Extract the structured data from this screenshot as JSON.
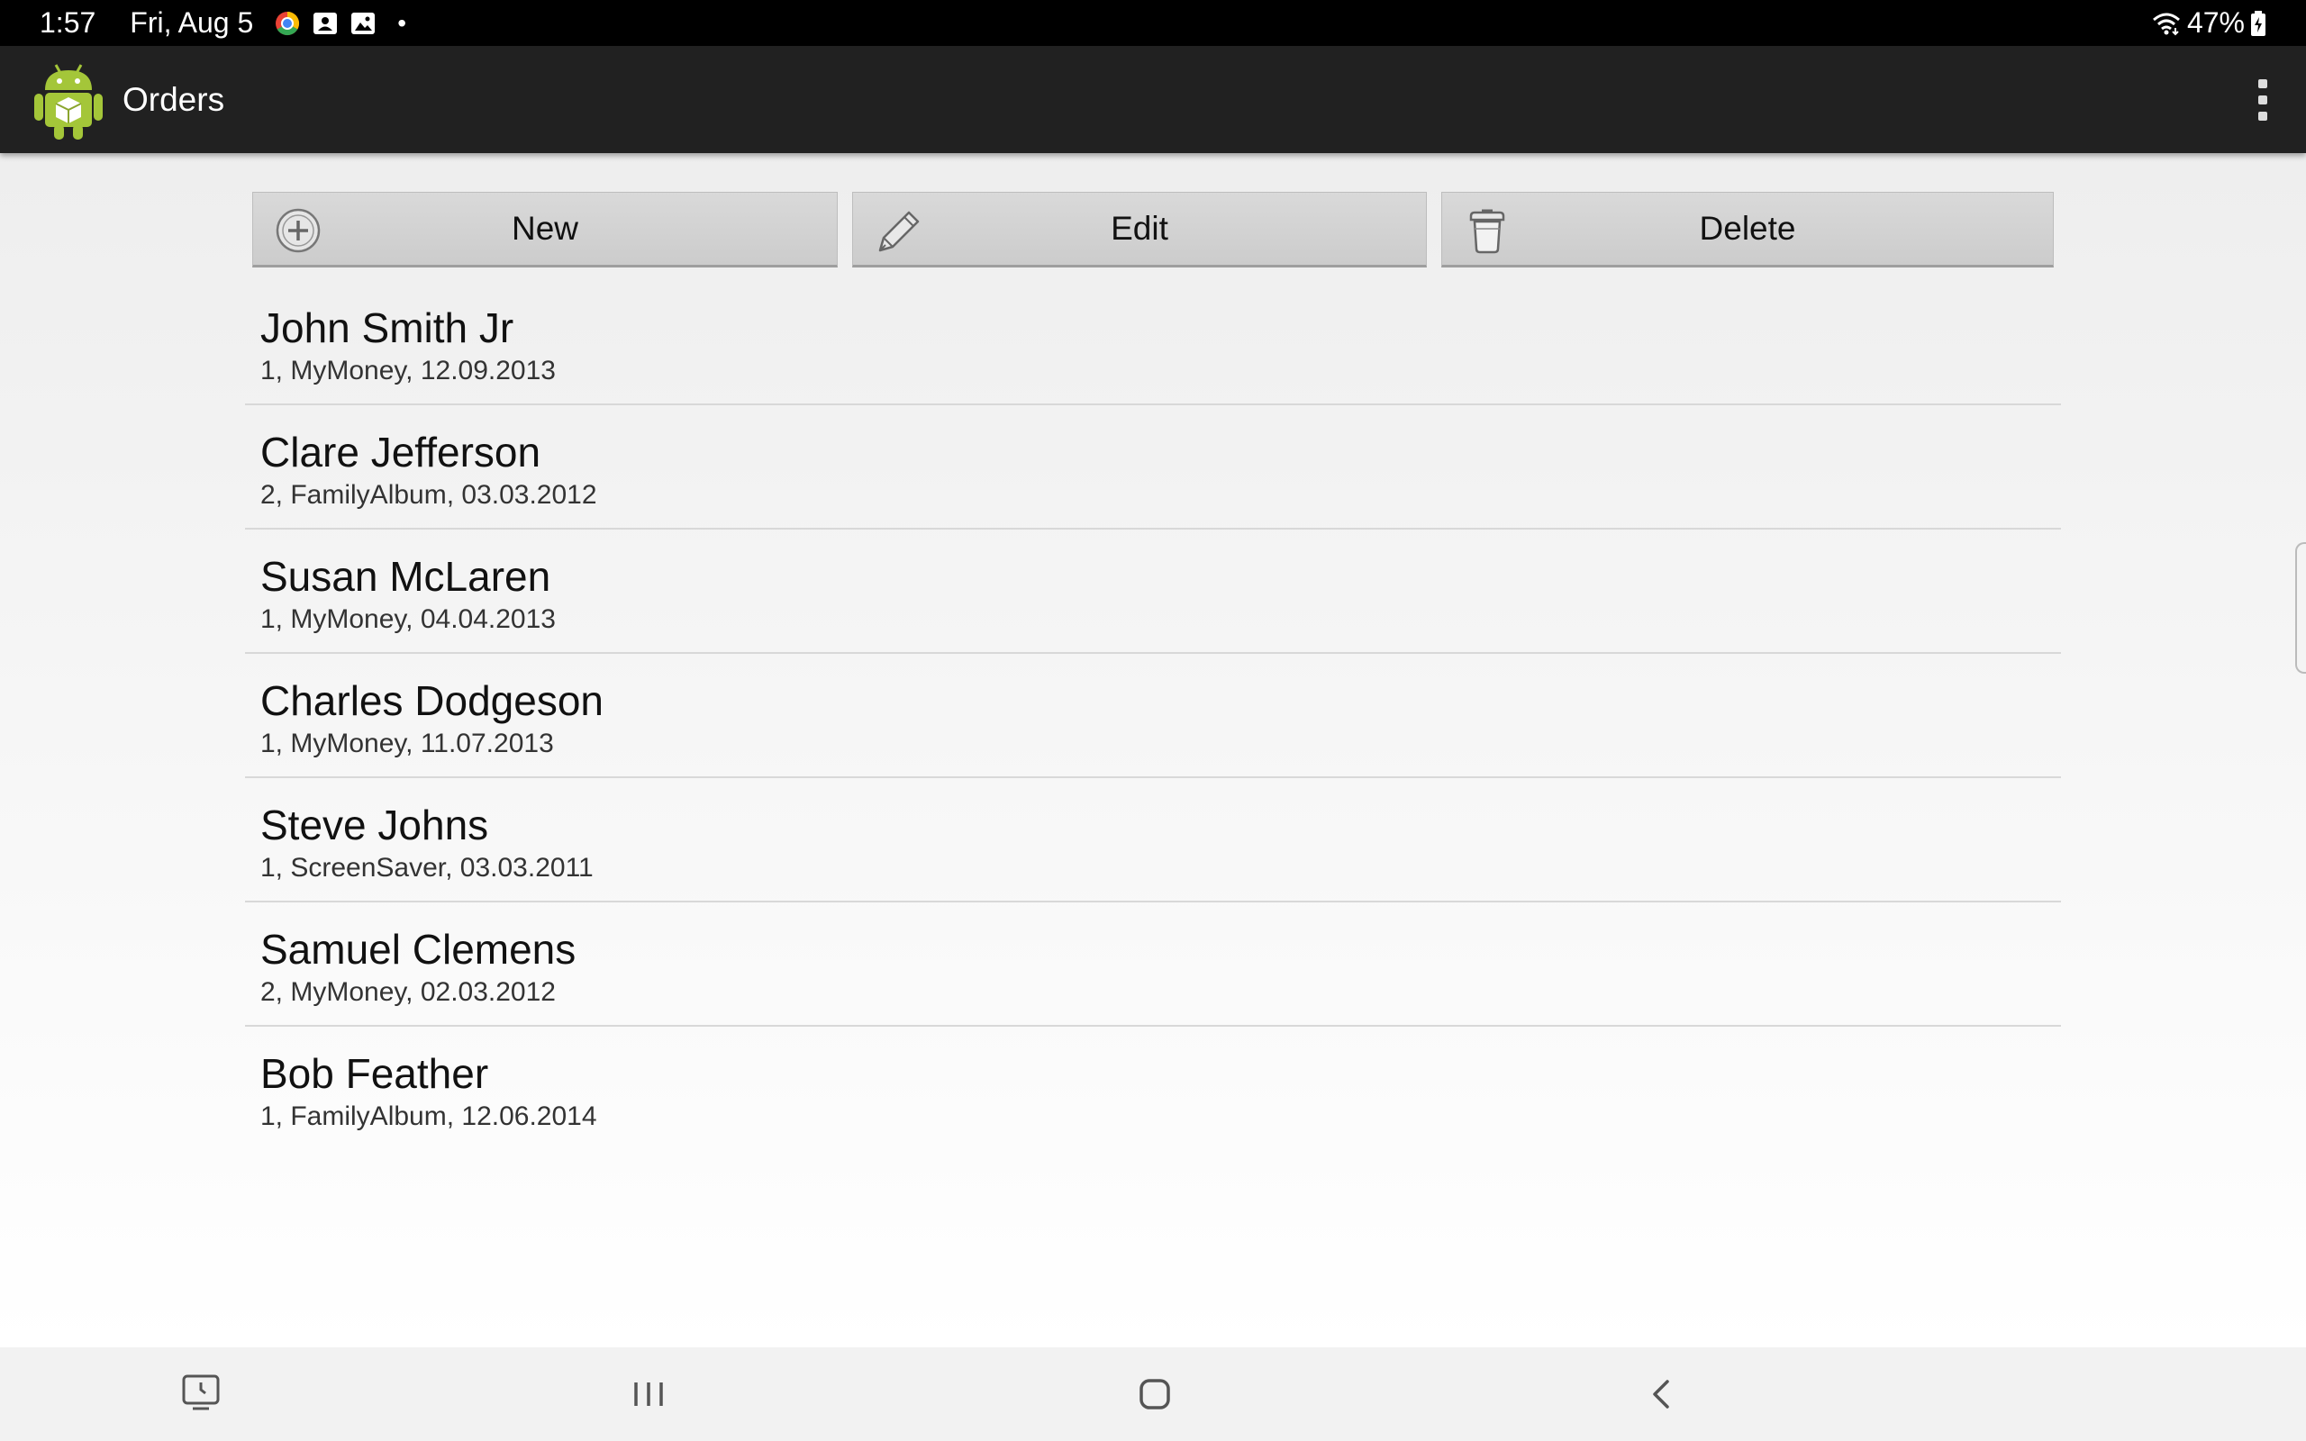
{
  "status_bar": {
    "time": "1:57",
    "date": "Fri, Aug 5",
    "dot": "•",
    "battery": "47%"
  },
  "action_bar": {
    "title": "Orders"
  },
  "toolbar": {
    "new_label": "New",
    "edit_label": "Edit",
    "delete_label": "Delete"
  },
  "orders": [
    {
      "name": "John Smith Jr",
      "detail": "1, MyMoney, 12.09.2013"
    },
    {
      "name": "Clare Jefferson",
      "detail": "2, FamilyAlbum, 03.03.2012"
    },
    {
      "name": "Susan McLaren",
      "detail": "1, MyMoney, 04.04.2013"
    },
    {
      "name": "Charles Dodgeson",
      "detail": "1, MyMoney, 11.07.2013"
    },
    {
      "name": "Steve Johns",
      "detail": "1, ScreenSaver, 03.03.2011"
    },
    {
      "name": "Samuel Clemens",
      "detail": "2, MyMoney, 02.03.2012"
    },
    {
      "name": "Bob Feather",
      "detail": "1, FamilyAlbum, 12.06.2014"
    }
  ],
  "icons": {
    "app": "android-package-icon",
    "new": "plus-circle-icon",
    "edit": "pencil-icon",
    "delete": "trash-can-icon",
    "overflow": "more-vert-icon",
    "wifi": "wifi-icon",
    "battery": "battery-charging-icon",
    "nav_screen": "screen-capture-icon",
    "nav_recents": "recents-icon",
    "nav_home": "home-icon",
    "nav_back": "back-icon"
  },
  "colors": {
    "action_bar": "#212121",
    "status_bar": "#000000",
    "android_green": "#a4c639",
    "button_bg": "#d3d3d3"
  }
}
